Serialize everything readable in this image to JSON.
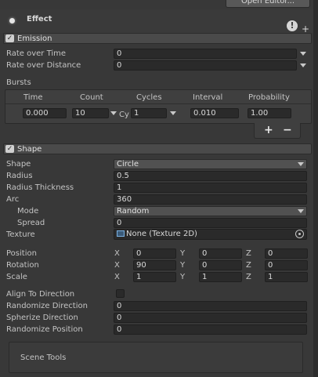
{
  "top": {
    "open_editor": "Open Editor..."
  },
  "effect": {
    "title": "Effect",
    "help": "!",
    "add": "+"
  },
  "emission": {
    "title": "Emission",
    "check": "✓",
    "rate_over_time": {
      "label": "Rate over Time",
      "value": "0"
    },
    "rate_over_distance": {
      "label": "Rate over Distance",
      "value": "0"
    },
    "bursts_label": "Bursts",
    "bursts": {
      "headers": [
        "Time",
        "Count",
        "Cycles",
        "Interval",
        "Probability"
      ],
      "row": {
        "time": "0.000",
        "count": "10",
        "cycles_prefix": "Cy",
        "cycles": "1",
        "interval": "0.010",
        "probability": "1.00"
      },
      "add": "+",
      "remove": "−"
    }
  },
  "shape": {
    "title": "Shape",
    "check": "✓",
    "shape": {
      "label": "Shape",
      "value": "Circle"
    },
    "radius": {
      "label": "Radius",
      "value": "0.5"
    },
    "radius_thickness": {
      "label": "Radius Thickness",
      "value": "1"
    },
    "arc": {
      "label": "Arc",
      "value": "360"
    },
    "mode": {
      "label": "Mode",
      "value": "Random"
    },
    "spread": {
      "label": "Spread",
      "value": "0"
    },
    "texture": {
      "label": "Texture",
      "value": "None (Texture 2D)"
    },
    "axes": {
      "x": "X",
      "y": "Y",
      "z": "Z"
    },
    "position": {
      "label": "Position",
      "x": "0",
      "y": "0",
      "z": "0"
    },
    "rotation": {
      "label": "Rotation",
      "x": "90",
      "y": "0",
      "z": "0"
    },
    "scale": {
      "label": "Scale",
      "x": "1",
      "y": "1",
      "z": "1"
    },
    "align_to_direction": {
      "label": "Align To Direction"
    },
    "randomize_direction": {
      "label": "Randomize Direction",
      "value": "0"
    },
    "spherize_direction": {
      "label": "Spherize Direction",
      "value": "0"
    },
    "randomize_position": {
      "label": "Randomize Position",
      "value": "0"
    }
  },
  "scene_tools": {
    "label": "Scene Tools"
  }
}
